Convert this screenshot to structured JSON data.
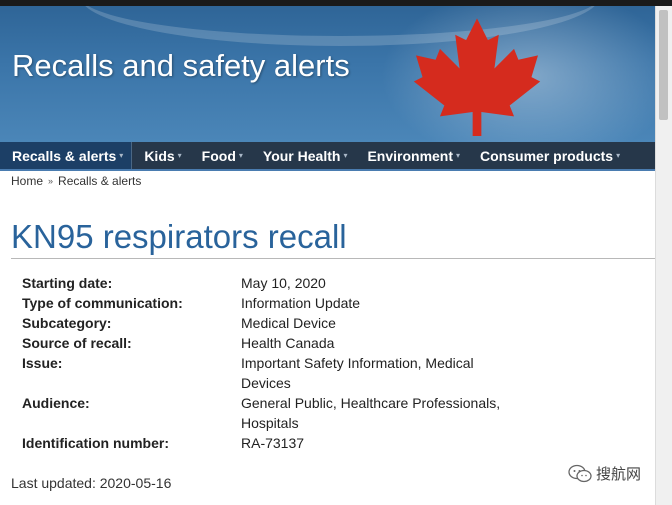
{
  "banner": {
    "title": "Recalls and safety alerts"
  },
  "nav": {
    "items": [
      {
        "label": "Recalls & alerts",
        "active": true
      },
      {
        "label": "Kids"
      },
      {
        "label": "Food"
      },
      {
        "label": "Your Health"
      },
      {
        "label": "Environment"
      },
      {
        "label": "Consumer products"
      }
    ],
    "arrow": "▾"
  },
  "breadcrumb": {
    "home": "Home",
    "current": "Recalls & alerts",
    "separator": "»"
  },
  "page": {
    "title": "KN95 respirators recall"
  },
  "details": [
    {
      "label": "Starting date:",
      "value": "May 10, 2020"
    },
    {
      "label": "Type of communication:",
      "value": "Information Update"
    },
    {
      "label": "Subcategory:",
      "value": "Medical Device"
    },
    {
      "label": "Source of recall:",
      "value": "Health Canada"
    },
    {
      "label": "Issue:",
      "value": "Important Safety Information, Medical Devices"
    },
    {
      "label": "Audience:",
      "value": "General Public, Healthcare Professionals, Hospitals"
    },
    {
      "label": "Identification number:",
      "value": "RA-73137"
    }
  ],
  "footer": {
    "last_updated": "Last updated: 2020-05-16"
  },
  "watermark": {
    "text": "搜航网",
    "icon": "wechat-icon"
  },
  "colors": {
    "nav_bg": "#26374a",
    "title": "#29639b",
    "maple": "#d52b1e"
  }
}
